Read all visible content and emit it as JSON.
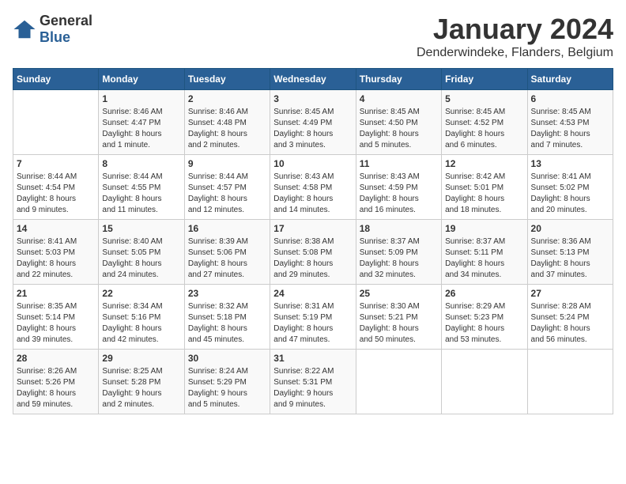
{
  "header": {
    "logo_general": "General",
    "logo_blue": "Blue",
    "month_year": "January 2024",
    "location": "Denderwindeke, Flanders, Belgium"
  },
  "days_of_week": [
    "Sunday",
    "Monday",
    "Tuesday",
    "Wednesday",
    "Thursday",
    "Friday",
    "Saturday"
  ],
  "weeks": [
    [
      {
        "day": "",
        "info": ""
      },
      {
        "day": "1",
        "info": "Sunrise: 8:46 AM\nSunset: 4:47 PM\nDaylight: 8 hours\nand 1 minute."
      },
      {
        "day": "2",
        "info": "Sunrise: 8:46 AM\nSunset: 4:48 PM\nDaylight: 8 hours\nand 2 minutes."
      },
      {
        "day": "3",
        "info": "Sunrise: 8:45 AM\nSunset: 4:49 PM\nDaylight: 8 hours\nand 3 minutes."
      },
      {
        "day": "4",
        "info": "Sunrise: 8:45 AM\nSunset: 4:50 PM\nDaylight: 8 hours\nand 5 minutes."
      },
      {
        "day": "5",
        "info": "Sunrise: 8:45 AM\nSunset: 4:52 PM\nDaylight: 8 hours\nand 6 minutes."
      },
      {
        "day": "6",
        "info": "Sunrise: 8:45 AM\nSunset: 4:53 PM\nDaylight: 8 hours\nand 7 minutes."
      }
    ],
    [
      {
        "day": "7",
        "info": "Sunrise: 8:44 AM\nSunset: 4:54 PM\nDaylight: 8 hours\nand 9 minutes."
      },
      {
        "day": "8",
        "info": "Sunrise: 8:44 AM\nSunset: 4:55 PM\nDaylight: 8 hours\nand 11 minutes."
      },
      {
        "day": "9",
        "info": "Sunrise: 8:44 AM\nSunset: 4:57 PM\nDaylight: 8 hours\nand 12 minutes."
      },
      {
        "day": "10",
        "info": "Sunrise: 8:43 AM\nSunset: 4:58 PM\nDaylight: 8 hours\nand 14 minutes."
      },
      {
        "day": "11",
        "info": "Sunrise: 8:43 AM\nSunset: 4:59 PM\nDaylight: 8 hours\nand 16 minutes."
      },
      {
        "day": "12",
        "info": "Sunrise: 8:42 AM\nSunset: 5:01 PM\nDaylight: 8 hours\nand 18 minutes."
      },
      {
        "day": "13",
        "info": "Sunrise: 8:41 AM\nSunset: 5:02 PM\nDaylight: 8 hours\nand 20 minutes."
      }
    ],
    [
      {
        "day": "14",
        "info": "Sunrise: 8:41 AM\nSunset: 5:03 PM\nDaylight: 8 hours\nand 22 minutes."
      },
      {
        "day": "15",
        "info": "Sunrise: 8:40 AM\nSunset: 5:05 PM\nDaylight: 8 hours\nand 24 minutes."
      },
      {
        "day": "16",
        "info": "Sunrise: 8:39 AM\nSunset: 5:06 PM\nDaylight: 8 hours\nand 27 minutes."
      },
      {
        "day": "17",
        "info": "Sunrise: 8:38 AM\nSunset: 5:08 PM\nDaylight: 8 hours\nand 29 minutes."
      },
      {
        "day": "18",
        "info": "Sunrise: 8:37 AM\nSunset: 5:09 PM\nDaylight: 8 hours\nand 32 minutes."
      },
      {
        "day": "19",
        "info": "Sunrise: 8:37 AM\nSunset: 5:11 PM\nDaylight: 8 hours\nand 34 minutes."
      },
      {
        "day": "20",
        "info": "Sunrise: 8:36 AM\nSunset: 5:13 PM\nDaylight: 8 hours\nand 37 minutes."
      }
    ],
    [
      {
        "day": "21",
        "info": "Sunrise: 8:35 AM\nSunset: 5:14 PM\nDaylight: 8 hours\nand 39 minutes."
      },
      {
        "day": "22",
        "info": "Sunrise: 8:34 AM\nSunset: 5:16 PM\nDaylight: 8 hours\nand 42 minutes."
      },
      {
        "day": "23",
        "info": "Sunrise: 8:32 AM\nSunset: 5:18 PM\nDaylight: 8 hours\nand 45 minutes."
      },
      {
        "day": "24",
        "info": "Sunrise: 8:31 AM\nSunset: 5:19 PM\nDaylight: 8 hours\nand 47 minutes."
      },
      {
        "day": "25",
        "info": "Sunrise: 8:30 AM\nSunset: 5:21 PM\nDaylight: 8 hours\nand 50 minutes."
      },
      {
        "day": "26",
        "info": "Sunrise: 8:29 AM\nSunset: 5:23 PM\nDaylight: 8 hours\nand 53 minutes."
      },
      {
        "day": "27",
        "info": "Sunrise: 8:28 AM\nSunset: 5:24 PM\nDaylight: 8 hours\nand 56 minutes."
      }
    ],
    [
      {
        "day": "28",
        "info": "Sunrise: 8:26 AM\nSunset: 5:26 PM\nDaylight: 8 hours\nand 59 minutes."
      },
      {
        "day": "29",
        "info": "Sunrise: 8:25 AM\nSunset: 5:28 PM\nDaylight: 9 hours\nand 2 minutes."
      },
      {
        "day": "30",
        "info": "Sunrise: 8:24 AM\nSunset: 5:29 PM\nDaylight: 9 hours\nand 5 minutes."
      },
      {
        "day": "31",
        "info": "Sunrise: 8:22 AM\nSunset: 5:31 PM\nDaylight: 9 hours\nand 9 minutes."
      },
      {
        "day": "",
        "info": ""
      },
      {
        "day": "",
        "info": ""
      },
      {
        "day": "",
        "info": ""
      }
    ]
  ]
}
